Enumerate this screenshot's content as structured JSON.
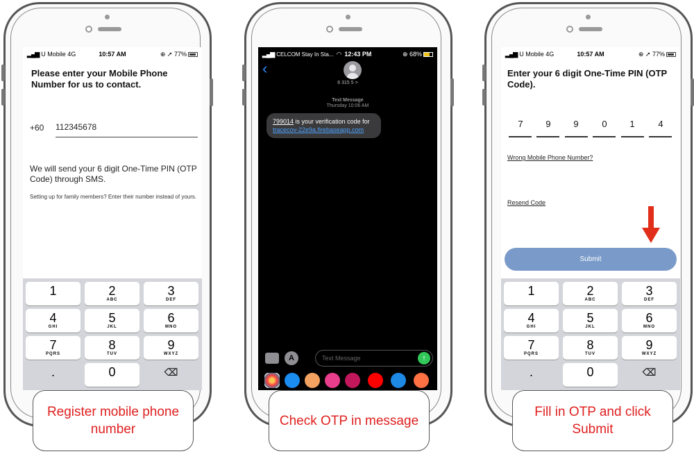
{
  "colors": {
    "accent": "#e02020",
    "submit": "#7a9bc9",
    "link": "#4da3ff"
  },
  "keypad": {
    "keys": [
      {
        "n": "1",
        "l": ""
      },
      {
        "n": "2",
        "l": "ABC"
      },
      {
        "n": "3",
        "l": "DEF"
      },
      {
        "n": "4",
        "l": "GHI"
      },
      {
        "n": "5",
        "l": "JKL"
      },
      {
        "n": "6",
        "l": "MNO"
      },
      {
        "n": "7",
        "l": "PQRS"
      },
      {
        "n": "8",
        "l": "TUV"
      },
      {
        "n": "9",
        "l": "WXYZ"
      }
    ],
    "dot": ".",
    "zero": "0",
    "delete_icon": "backspace-icon"
  },
  "screen1": {
    "status": {
      "carrier": "U Mobile",
      "network": "4G",
      "time": "10:57 AM",
      "battery": "77%"
    },
    "title": "Please enter your Mobile Phone Number for us to contact.",
    "country_code": "+60",
    "phone_value": "112345678",
    "info": "We will send your 6 digit One-Time PIN (OTP Code) through SMS.",
    "family_note": "Setting up for family members? Enter their number instead of yours.",
    "caption": "Register mobile phone number"
  },
  "screen2": {
    "status": {
      "carrier": "CELCOM Stay In Sta...",
      "time": "12:43 PM",
      "battery": "68%"
    },
    "contact": "6 315 5 >",
    "timestamp_label": "Text Message",
    "timestamp": "Thursday 10:06 AM",
    "message_code": "799014",
    "message_text": " is your verification code for ",
    "message_url": "tracecov-22e9a.firebaseapp.com",
    "input_placeholder": "Text Message",
    "caption": "Check OTP in message"
  },
  "screen3": {
    "status": {
      "carrier": "U Mobile",
      "network": "4G",
      "time": "10:57 AM",
      "battery": "77%"
    },
    "title": "Enter your 6 digit One-Time PIN (OTP Code).",
    "otp": [
      "7",
      "9",
      "9",
      "0",
      "1",
      "4"
    ],
    "wrong_number": "Wrong Mobile Phone Number?",
    "resend": "Resend Code",
    "submit": "Submit",
    "caption": "Fill in OTP and click Submit"
  }
}
